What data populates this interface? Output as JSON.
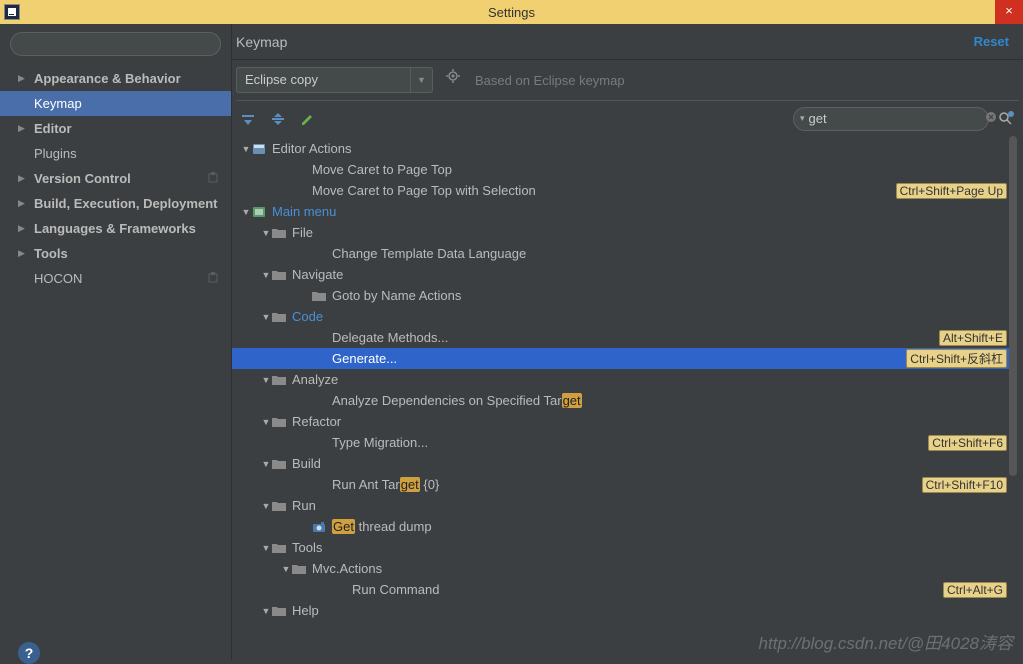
{
  "window": {
    "title": "Settings"
  },
  "sidebar": {
    "search_placeholder": "",
    "items": [
      {
        "label": "Appearance & Behavior",
        "arrow": true,
        "bold": true
      },
      {
        "label": "Keymap",
        "arrow": false,
        "bold": false,
        "selected": true
      },
      {
        "label": "Editor",
        "arrow": true,
        "bold": true
      },
      {
        "label": "Plugins",
        "arrow": false,
        "bold": false
      },
      {
        "label": "Version Control",
        "arrow": true,
        "bold": true,
        "gear": true
      },
      {
        "label": "Build, Execution, Deployment",
        "arrow": true,
        "bold": true
      },
      {
        "label": "Languages & Frameworks",
        "arrow": true,
        "bold": true
      },
      {
        "label": "Tools",
        "arrow": true,
        "bold": true
      },
      {
        "label": "HOCON",
        "arrow": false,
        "bold": false,
        "gear": true
      }
    ]
  },
  "header": {
    "breadcrumb": "Keymap",
    "reset": "Reset"
  },
  "keymap_selector": {
    "value": "Eclipse copy",
    "based_on": "Based on Eclipse keymap"
  },
  "search": {
    "value": "get"
  },
  "tree": {
    "editor_actions": "Editor Actions",
    "move_caret_top": "Move Caret to Page Top",
    "move_caret_top_sel": "Move Caret to Page Top with Selection",
    "move_caret_top_sel_sc": "Ctrl+Shift+Page Up",
    "main_menu": "Main menu",
    "file": "File",
    "change_template": "Change Template Data Language",
    "navigate": "Navigate",
    "goto_by_name": "Goto by Name Actions",
    "code": "Code",
    "delegate_methods": "Delegate Methods...",
    "delegate_methods_sc": "Alt+Shift+E",
    "generate": "Generate...",
    "generate_sc": "Ctrl+Shift+反斜杠",
    "analyze": "Analyze",
    "analyze_deps_pre": "Analyze Dependencies on Specified Tar",
    "analyze_deps_hl": "get",
    "refactor": "Refactor",
    "type_migration": "Type Migration...",
    "type_migration_sc": "Ctrl+Shift+F6",
    "build": "Build",
    "run_ant_pre": "Run Ant Tar",
    "run_ant_hl": "get",
    "run_ant_post": " {0}",
    "run_ant_sc": "Ctrl+Shift+F10",
    "run": "Run",
    "get_thread_hl": "Get",
    "get_thread_post": " thread dump",
    "tools": "Tools",
    "mvc_actions": "Mvc.Actions",
    "run_command": "Run Command",
    "run_command_sc": "Ctrl+Alt+G",
    "help": "Help"
  },
  "watermark": "http://blog.csdn.net/@田4028涛容"
}
